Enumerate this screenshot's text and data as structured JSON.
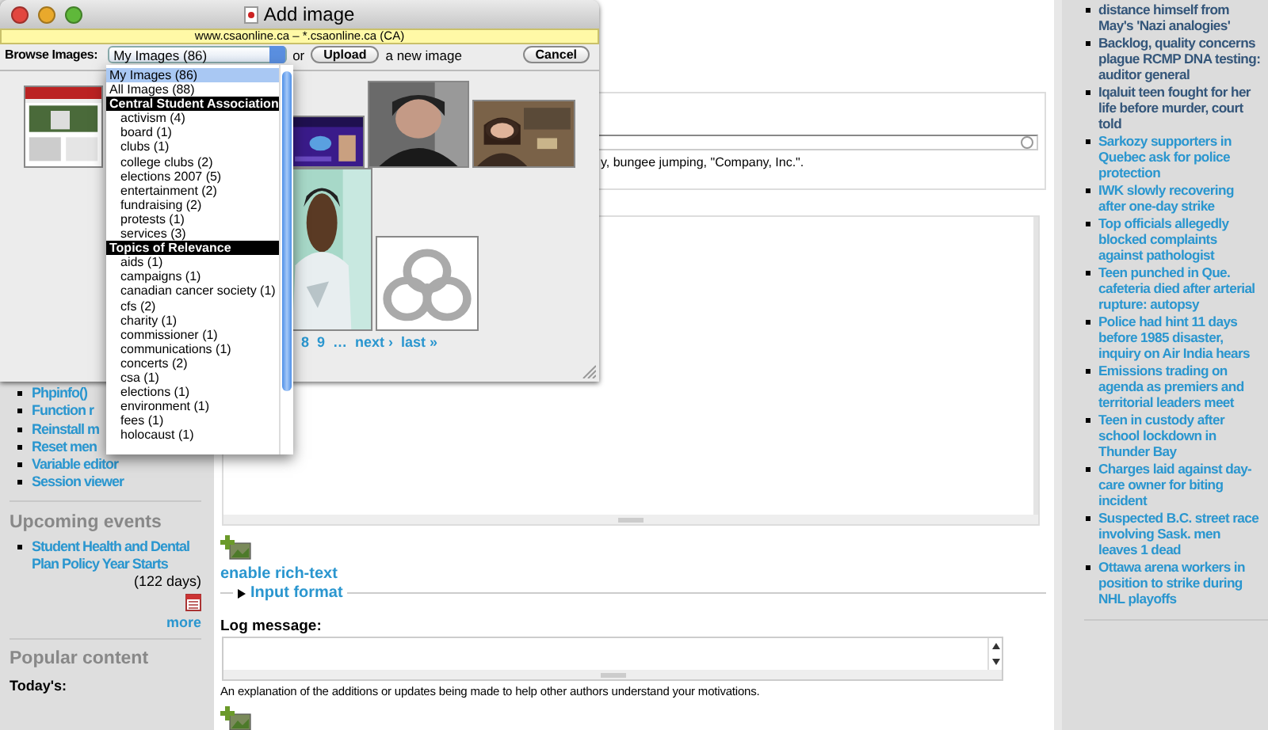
{
  "dialog": {
    "title": "Add image",
    "site_bar": "www.csaonline.ca  –  *.csaonline.ca (CA)",
    "browse_label": "Browse Images:",
    "select_value": "My Images (86)",
    "or_text": "or",
    "upload_button": "Upload",
    "new_image_text": "a new image",
    "cancel_button": "Cancel",
    "pager": [
      "8",
      "9",
      "…",
      "next ›",
      "last »"
    ]
  },
  "dropdown": {
    "options": [
      {
        "kind": "option",
        "label": "My Images (86)",
        "selected": true
      },
      {
        "kind": "option",
        "label": "All Images (88)",
        "selected": false
      },
      {
        "kind": "group",
        "label": "Central Student Association"
      },
      {
        "kind": "suboption",
        "label": "activism (4)",
        "selected": false
      },
      {
        "kind": "suboption",
        "label": "board (1)",
        "selected": false
      },
      {
        "kind": "suboption",
        "label": "clubs (1)",
        "selected": false
      },
      {
        "kind": "suboption",
        "label": "college clubs (2)",
        "selected": false
      },
      {
        "kind": "suboption",
        "label": "elections 2007 (5)",
        "selected": false
      },
      {
        "kind": "suboption",
        "label": "entertainment (2)",
        "selected": false
      },
      {
        "kind": "suboption",
        "label": "fundraising (2)",
        "selected": false
      },
      {
        "kind": "suboption",
        "label": "protests (1)",
        "selected": false
      },
      {
        "kind": "suboption",
        "label": "services (3)",
        "selected": false
      },
      {
        "kind": "group",
        "label": "Topics of Relevance"
      },
      {
        "kind": "suboption",
        "label": "aids (1)",
        "selected": false
      },
      {
        "kind": "suboption",
        "label": "campaigns (1)",
        "selected": false
      },
      {
        "kind": "suboption",
        "label": "canadian cancer society (1)",
        "selected": false
      },
      {
        "kind": "suboption",
        "label": "cfs (2)",
        "selected": false
      },
      {
        "kind": "suboption",
        "label": "charity (1)",
        "selected": false
      },
      {
        "kind": "suboption",
        "label": "commissioner (1)",
        "selected": false
      },
      {
        "kind": "suboption",
        "label": "communications (1)",
        "selected": false
      },
      {
        "kind": "suboption",
        "label": "concerts (2)",
        "selected": false
      },
      {
        "kind": "suboption",
        "label": "csa (1)",
        "selected": false
      },
      {
        "kind": "suboption",
        "label": "elections (1)",
        "selected": false
      },
      {
        "kind": "suboption",
        "label": "environment (1)",
        "selected": false
      },
      {
        "kind": "suboption",
        "label": "fees (1)",
        "selected": false
      },
      {
        "kind": "suboption",
        "label": "holocaust (1)",
        "selected": false
      }
    ]
  },
  "sidebar": {
    "admin_links": [
      "Phpinfo()",
      "Function r",
      "Reinstall m",
      "Reset men",
      "Variable editor",
      "Session viewer"
    ],
    "upcoming": {
      "title": "Upcoming events",
      "events": [
        {
          "title": "Student Health and Dental Plan Policy Year Starts",
          "countdown": "(122 days)"
        }
      ],
      "more": "more"
    },
    "popular": {
      "title": "Popular content",
      "today_label": "Today's:"
    }
  },
  "content": {
    "tags_hint": "y, bungee jumping, \"Company, Inc.\".",
    "rich_text_link": "enable rich-text",
    "input_format": "Input format",
    "log_label": "Log message:",
    "log_description": "An explanation of the additions or updates being made to help other authors understand your motivations."
  },
  "news": [
    {
      "title": "distance himself from May's 'Nazi analogies'",
      "visited": true
    },
    {
      "title": "Backlog, quality concerns plague RCMP DNA testing: auditor general",
      "visited": true
    },
    {
      "title": "Iqaluit teen fought for her life before murder, court told",
      "visited": true
    },
    {
      "title": "Sarkozy supporters in Quebec ask for police protection",
      "visited": false
    },
    {
      "title": "IWK slowly recovering after one-day strike",
      "visited": false
    },
    {
      "title": "Top officials allegedly blocked complaints against pathologist",
      "visited": false
    },
    {
      "title": "Teen punched in Que. cafeteria died after arterial rupture: autopsy",
      "visited": false
    },
    {
      "title": "Police had hint 11 days before 1985 disaster, inquiry on Air India hears",
      "visited": false
    },
    {
      "title": "Emissions trading on agenda as premiers and territorial leaders meet",
      "visited": false
    },
    {
      "title": "Teen in custody after school lockdown in Thunder Bay",
      "visited": false
    },
    {
      "title": "Charges laid against day-care owner for biting incident",
      "visited": false
    },
    {
      "title": "Suspected B.C. street race involving Sask. men leaves 1 dead",
      "visited": false
    },
    {
      "title": "Ottawa arena workers in position to strike during NHL playoffs",
      "visited": false
    }
  ]
}
